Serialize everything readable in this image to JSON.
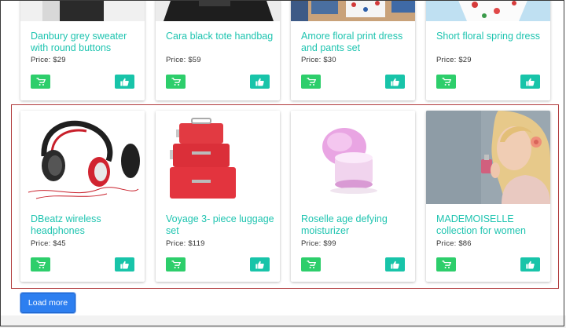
{
  "top_row": [
    {
      "title": "Danbury grey sweater with round buttons",
      "price": "Price: $29"
    },
    {
      "title": "Cara black tote handbag",
      "price": "Price: $59"
    },
    {
      "title": "Amore floral print dress and pants set",
      "price": "Price: $30"
    },
    {
      "title": "Short floral spring dress",
      "price": "Price: $29"
    }
  ],
  "bottom_row": [
    {
      "title": "DBeatz wireless headphones",
      "price": "Price: $45"
    },
    {
      "title": "Voyage 3- piece luggage set",
      "price": "Price: $119"
    },
    {
      "title": "Roselle age defying moisturizer",
      "price": "Price: $99"
    },
    {
      "title": "MADEMOISELLE collection for women",
      "price": "Price: $86"
    }
  ],
  "load_more_label": "Load more",
  "icons": {
    "cart": "add-to-cart-icon",
    "like": "thumbs-up-icon"
  },
  "colors": {
    "title": "#1fc4b0",
    "cart_button": "#2dce6b",
    "like_button": "#18c4a9",
    "highlight_border": "#b0393b",
    "load_more": "#2d7ff0"
  }
}
